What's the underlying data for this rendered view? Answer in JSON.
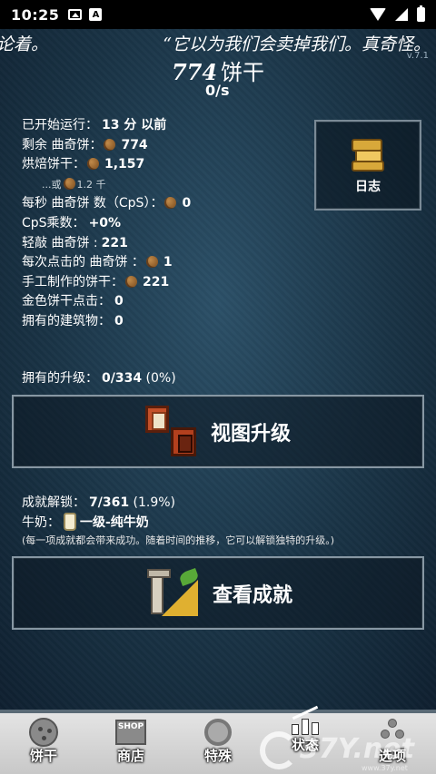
{
  "status_bar": {
    "time": "10:25",
    "a_icon": "A"
  },
  "ticker": {
    "left_text": "论着。",
    "right_text": "“它以为我们会卖掉我们。真奇怪。"
  },
  "version": "v.7.1",
  "cookies": {
    "count": "774",
    "unit": "饼干",
    "per_second": "0/s"
  },
  "stats": {
    "started": {
      "label": "已开始运行：",
      "value": "13 分 以前"
    },
    "remaining": {
      "label": "剩余 曲奇饼：",
      "value": "774"
    },
    "baked": {
      "label": "烘焙饼干：",
      "value": "1,157"
    },
    "baked_alt": {
      "prefix": "...或",
      "value": "1.2 千"
    },
    "cps": {
      "label": "每秒 曲奇饼 数（CpS）：",
      "value": "0"
    },
    "cps_mult": {
      "label": "CpS乘数：",
      "value": "+0%"
    },
    "tap": {
      "label": "轻敲 曲奇饼 :",
      "value": "221"
    },
    "per_click": {
      "label": "每次点击的 曲奇饼 ：",
      "value": "1"
    },
    "handmade": {
      "label": "手工制作的饼干：",
      "value": "221"
    },
    "golden": {
      "label": "金色饼干点击：",
      "value": "0"
    },
    "buildings": {
      "label": "拥有的建筑物：",
      "value": "0"
    }
  },
  "log_button": {
    "label": "日志",
    "icon": "scroll-icon"
  },
  "upgrades": {
    "label": "拥有的升级：",
    "value": "0/334",
    "pct": "(0%)",
    "button_label": "视图升级"
  },
  "achievements": {
    "label": "成就解锁：",
    "value": "7/361",
    "pct": "(1.9%)",
    "milk_label": "牛奶：",
    "milk_value": "一级-纯牛奶",
    "note": "(每一项成就都会带来成功。随着时间的推移，它可以解锁独特的升级。)",
    "button_label": "查看成就"
  },
  "tabs": [
    {
      "label": "饼干",
      "icon": "cookie-icon"
    },
    {
      "label": "商店",
      "icon": "shop-icon",
      "sign": "SHOP"
    },
    {
      "label": "特殊",
      "icon": "swirl-icon"
    },
    {
      "label": "状态",
      "icon": "stats-icon"
    },
    {
      "label": "选项",
      "icon": "dots-icon"
    }
  ],
  "watermark": {
    "text": "37Y.net",
    "small": "www.37y.net"
  }
}
